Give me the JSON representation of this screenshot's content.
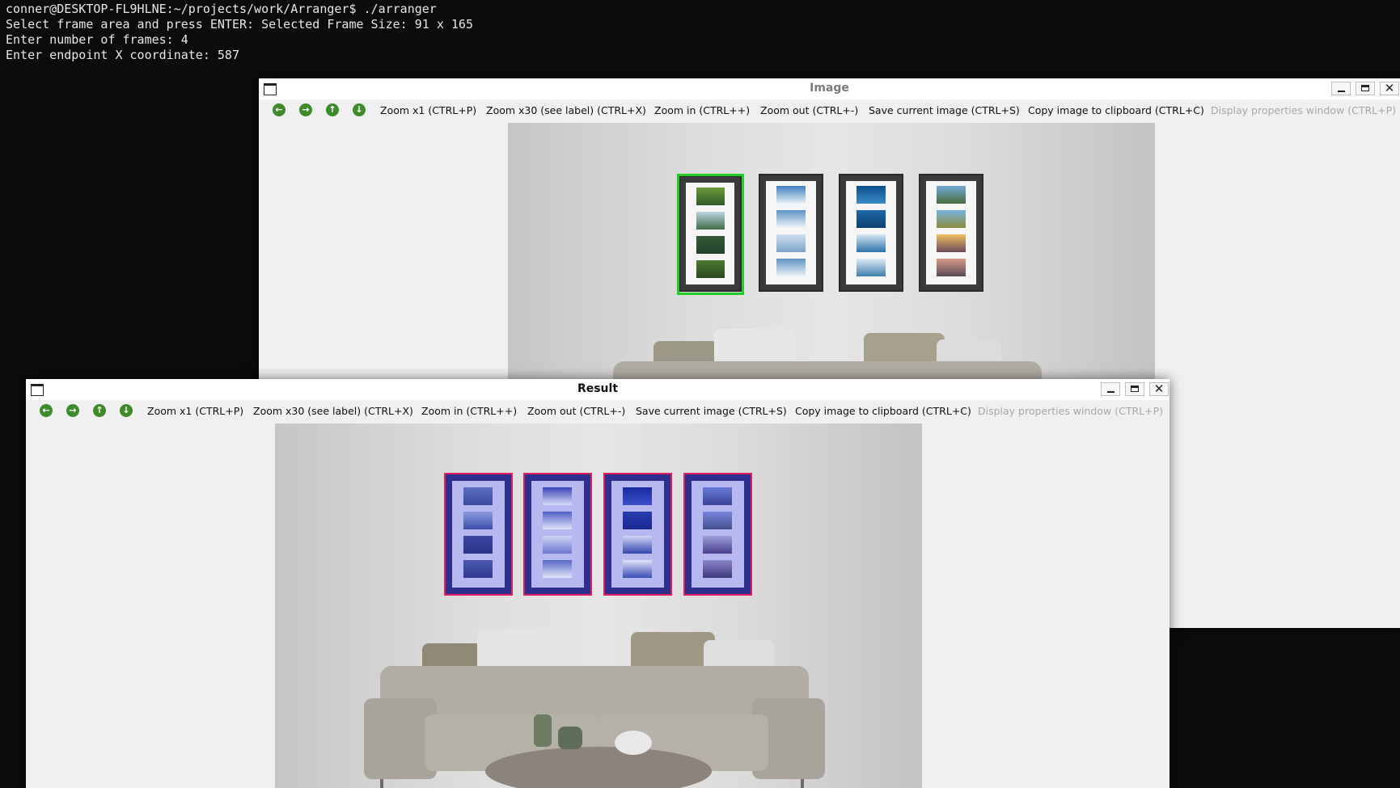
{
  "terminal": {
    "lines": [
      "conner@DESKTOP-FL9HLNE:~/projects/work/Arranger$ ./arranger",
      "Select frame area and press ENTER: Selected Frame Size: 91 x 165",
      "Enter number of frames: 4",
      "Enter endpoint X coordinate: 587"
    ]
  },
  "toolbar": {
    "nav_icons": [
      "arrow-left-icon",
      "arrow-right-icon",
      "arrow-up-icon",
      "arrow-down-icon"
    ],
    "zoom_x1": "Zoom x1 (CTRL+P)",
    "zoom_x30": "Zoom x30 (see label) (CTRL+X)",
    "zoom_in": "Zoom in (CTRL++)",
    "zoom_out": "Zoom out (CTRL+-)",
    "save_image": "Save current image (CTRL+S)",
    "copy_image": "Copy image to clipboard (CTRL+C)",
    "display_props": "Display properties window (CTRL+P)"
  },
  "image_window": {
    "title": "Image"
  },
  "result_window": {
    "title": "Result"
  },
  "window_controls": {
    "minimize": "minimize-icon",
    "maximize": "maximize-icon",
    "close": "close-icon",
    "close_glyph": "✕"
  },
  "colors": {
    "selection": "#22cc22",
    "frame_outline": "#e0205a",
    "frame_tint": "#2f2f8f",
    "toolbar_icon": "#3f8a2a"
  }
}
